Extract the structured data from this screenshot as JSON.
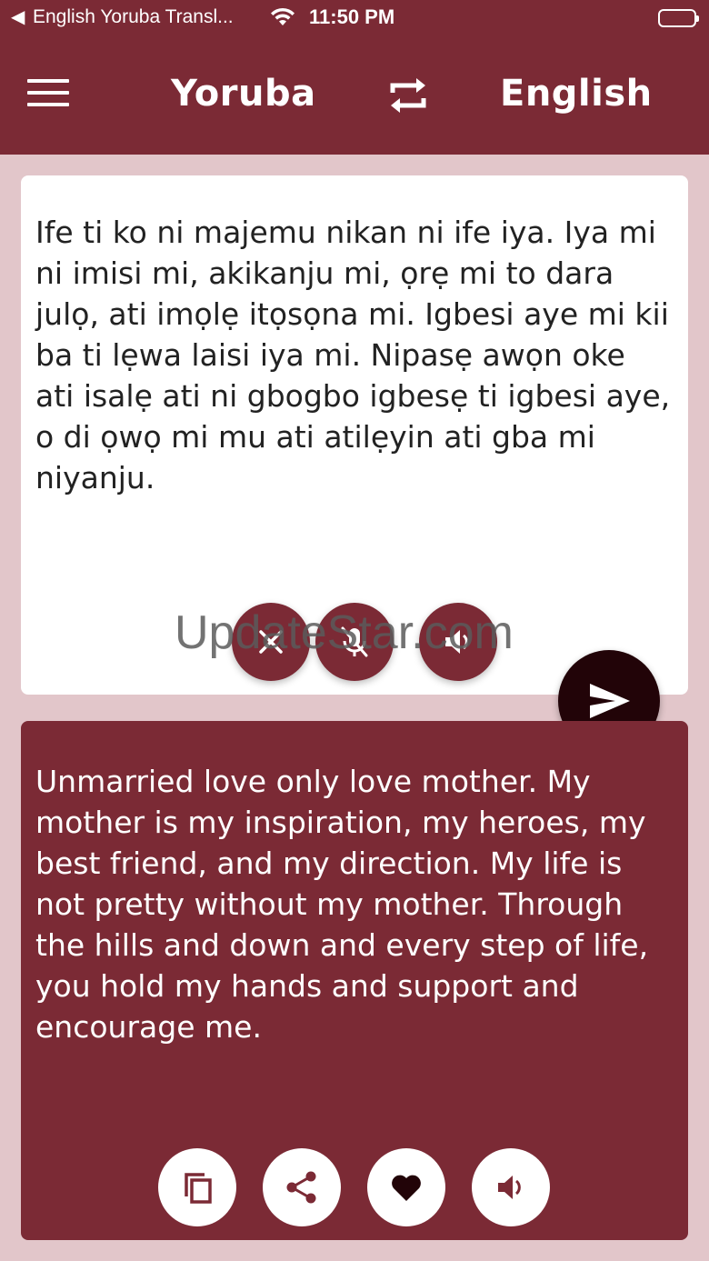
{
  "status_bar": {
    "back_glyph": "◀",
    "app_name": "English Yoruba Transl...",
    "time": "11:50 PM"
  },
  "app_bar": {
    "source_language": "Yoruba",
    "target_language": "English",
    "menu_icon": "hamburger-menu-icon",
    "swap_icon": "swap-arrows-icon"
  },
  "input": {
    "text": "Ife ti ko ni majemu nikan ni ife iya. Iya mi ni imisi mi, akikanju mi, ọrẹ mi to dara julọ, ati imọlẹ itọsọna mi. Igbesi aye mi kii ba ti lẹwa laisi iya mi. Nipasẹ awọn oke ati isalẹ ati ni gbogbo igbesẹ ti igbesi aye, o di ọwọ mi mu ati atilẹyin ati gba mi niyanju."
  },
  "output": {
    "text": "Unmarried love only love mother. My mother is my inspiration, my heroes, my best friend, and my direction. My life is not pretty without my mother. Through the hills and down and every step of life, you hold my hands and support and encourage me."
  },
  "watermark": "UpdateStar.com",
  "colors": {
    "primary": "#7b2a35",
    "background": "#e2c6ca",
    "send": "#220408"
  }
}
